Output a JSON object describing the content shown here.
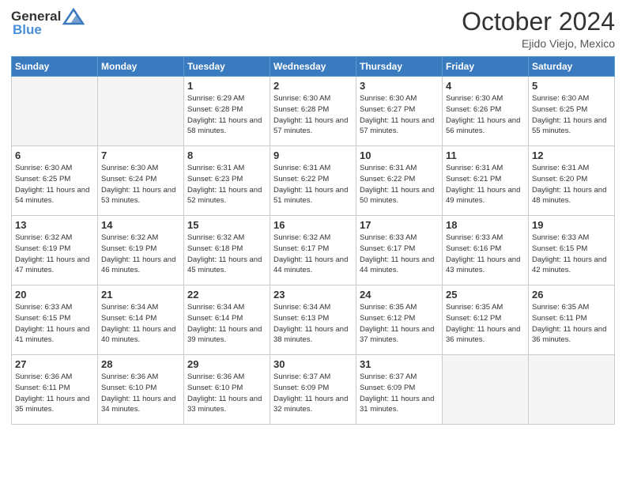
{
  "header": {
    "logo_general": "General",
    "logo_blue": "Blue",
    "month": "October 2024",
    "location": "Ejido Viejo, Mexico"
  },
  "days_of_week": [
    "Sunday",
    "Monday",
    "Tuesday",
    "Wednesday",
    "Thursday",
    "Friday",
    "Saturday"
  ],
  "weeks": [
    [
      {
        "day": "",
        "info": ""
      },
      {
        "day": "",
        "info": ""
      },
      {
        "day": "1",
        "info": "Sunrise: 6:29 AM\nSunset: 6:28 PM\nDaylight: 11 hours and 58 minutes."
      },
      {
        "day": "2",
        "info": "Sunrise: 6:30 AM\nSunset: 6:28 PM\nDaylight: 11 hours and 57 minutes."
      },
      {
        "day": "3",
        "info": "Sunrise: 6:30 AM\nSunset: 6:27 PM\nDaylight: 11 hours and 57 minutes."
      },
      {
        "day": "4",
        "info": "Sunrise: 6:30 AM\nSunset: 6:26 PM\nDaylight: 11 hours and 56 minutes."
      },
      {
        "day": "5",
        "info": "Sunrise: 6:30 AM\nSunset: 6:25 PM\nDaylight: 11 hours and 55 minutes."
      }
    ],
    [
      {
        "day": "6",
        "info": "Sunrise: 6:30 AM\nSunset: 6:25 PM\nDaylight: 11 hours and 54 minutes."
      },
      {
        "day": "7",
        "info": "Sunrise: 6:30 AM\nSunset: 6:24 PM\nDaylight: 11 hours and 53 minutes."
      },
      {
        "day": "8",
        "info": "Sunrise: 6:31 AM\nSunset: 6:23 PM\nDaylight: 11 hours and 52 minutes."
      },
      {
        "day": "9",
        "info": "Sunrise: 6:31 AM\nSunset: 6:22 PM\nDaylight: 11 hours and 51 minutes."
      },
      {
        "day": "10",
        "info": "Sunrise: 6:31 AM\nSunset: 6:22 PM\nDaylight: 11 hours and 50 minutes."
      },
      {
        "day": "11",
        "info": "Sunrise: 6:31 AM\nSunset: 6:21 PM\nDaylight: 11 hours and 49 minutes."
      },
      {
        "day": "12",
        "info": "Sunrise: 6:31 AM\nSunset: 6:20 PM\nDaylight: 11 hours and 48 minutes."
      }
    ],
    [
      {
        "day": "13",
        "info": "Sunrise: 6:32 AM\nSunset: 6:19 PM\nDaylight: 11 hours and 47 minutes."
      },
      {
        "day": "14",
        "info": "Sunrise: 6:32 AM\nSunset: 6:19 PM\nDaylight: 11 hours and 46 minutes."
      },
      {
        "day": "15",
        "info": "Sunrise: 6:32 AM\nSunset: 6:18 PM\nDaylight: 11 hours and 45 minutes."
      },
      {
        "day": "16",
        "info": "Sunrise: 6:32 AM\nSunset: 6:17 PM\nDaylight: 11 hours and 44 minutes."
      },
      {
        "day": "17",
        "info": "Sunrise: 6:33 AM\nSunset: 6:17 PM\nDaylight: 11 hours and 44 minutes."
      },
      {
        "day": "18",
        "info": "Sunrise: 6:33 AM\nSunset: 6:16 PM\nDaylight: 11 hours and 43 minutes."
      },
      {
        "day": "19",
        "info": "Sunrise: 6:33 AM\nSunset: 6:15 PM\nDaylight: 11 hours and 42 minutes."
      }
    ],
    [
      {
        "day": "20",
        "info": "Sunrise: 6:33 AM\nSunset: 6:15 PM\nDaylight: 11 hours and 41 minutes."
      },
      {
        "day": "21",
        "info": "Sunrise: 6:34 AM\nSunset: 6:14 PM\nDaylight: 11 hours and 40 minutes."
      },
      {
        "day": "22",
        "info": "Sunrise: 6:34 AM\nSunset: 6:14 PM\nDaylight: 11 hours and 39 minutes."
      },
      {
        "day": "23",
        "info": "Sunrise: 6:34 AM\nSunset: 6:13 PM\nDaylight: 11 hours and 38 minutes."
      },
      {
        "day": "24",
        "info": "Sunrise: 6:35 AM\nSunset: 6:12 PM\nDaylight: 11 hours and 37 minutes."
      },
      {
        "day": "25",
        "info": "Sunrise: 6:35 AM\nSunset: 6:12 PM\nDaylight: 11 hours and 36 minutes."
      },
      {
        "day": "26",
        "info": "Sunrise: 6:35 AM\nSunset: 6:11 PM\nDaylight: 11 hours and 36 minutes."
      }
    ],
    [
      {
        "day": "27",
        "info": "Sunrise: 6:36 AM\nSunset: 6:11 PM\nDaylight: 11 hours and 35 minutes."
      },
      {
        "day": "28",
        "info": "Sunrise: 6:36 AM\nSunset: 6:10 PM\nDaylight: 11 hours and 34 minutes."
      },
      {
        "day": "29",
        "info": "Sunrise: 6:36 AM\nSunset: 6:10 PM\nDaylight: 11 hours and 33 minutes."
      },
      {
        "day": "30",
        "info": "Sunrise: 6:37 AM\nSunset: 6:09 PM\nDaylight: 11 hours and 32 minutes."
      },
      {
        "day": "31",
        "info": "Sunrise: 6:37 AM\nSunset: 6:09 PM\nDaylight: 11 hours and 31 minutes."
      },
      {
        "day": "",
        "info": ""
      },
      {
        "day": "",
        "info": ""
      }
    ]
  ]
}
